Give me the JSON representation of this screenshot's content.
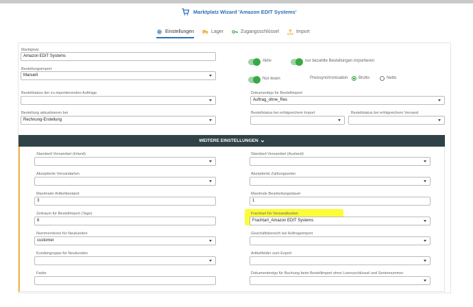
{
  "header": {
    "title": "Marktplatz Wizard 'Amazon EDIT Systems'"
  },
  "tabs": [
    {
      "label": "Einstellungen"
    },
    {
      "label": "Lager"
    },
    {
      "label": "Zugangsschlüssel"
    },
    {
      "label": "Import"
    }
  ],
  "main": {
    "marktplatz": {
      "label": "Marktplatz",
      "value": "Amazon EDIT Systems"
    },
    "bestellungsimport": {
      "label": "Bestellungsimport",
      "value": "Manuell"
    },
    "bestellstatus_import": {
      "label": "Bestellstatus der zu importierenden Aufträge",
      "value": ""
    },
    "bestellung_aktualisieren": {
      "label": "Bestellung aktualisieren bei",
      "value": "Rechnung-Erstellung"
    },
    "aktiv": {
      "label": "Aktiv",
      "on": true
    },
    "nur_bezahlte": {
      "label": "nur bezahlte Bestellungen importieren",
      "on": true
    },
    "nur_lesen": {
      "label": "Nur lesen",
      "on": true
    },
    "preissync": {
      "label": "Preissynchronisation",
      "options": [
        "Brutto",
        "Netto"
      ],
      "selected": "Brutto"
    },
    "dokumenttyp": {
      "label": "Dokumenttyp für Bestellimport",
      "value": "Auftrag_ohne_Res"
    },
    "status_erfolg_import": {
      "label": "Bestellstatus bei erfolgreichem Import",
      "value": ""
    },
    "status_erfolg_versand": {
      "label": "Bestellstatus bei erfolgreichem Versand",
      "value": ""
    }
  },
  "more_settings": {
    "button_label": "WEITERE EINSTELLUNGEN",
    "left": [
      {
        "label": "Standard Versandart (Inland)",
        "value": "",
        "dropdown": true
      },
      {
        "label": "Akzeptierte Versandarten",
        "value": "",
        "dropdown": true
      },
      {
        "label": "Maximaler Artikelbestand",
        "value": "3",
        "dropdown": false
      },
      {
        "label": "Zeitraum für Bestellimport (Tage)",
        "value": "6",
        "dropdown": false
      },
      {
        "label": "Nummernkreis für Neukunden",
        "value": "customer",
        "dropdown": true
      },
      {
        "label": "Kundengruppe für Neukunden",
        "value": "",
        "dropdown": true
      },
      {
        "label": "Farbe",
        "value": "",
        "dropdown": false
      }
    ],
    "right": [
      {
        "label": "Standard Versandart (Ausland)",
        "value": "",
        "dropdown": true
      },
      {
        "label": "Akzeptierte Zahlungsarten",
        "value": "",
        "dropdown": true
      },
      {
        "label": "Maximale Bearbeitungsdauer",
        "value": "1",
        "dropdown": false
      },
      {
        "label": "Frachtart für Versandkosten",
        "value": "Frachtart_Amazon EDIT Systems",
        "dropdown": true
      },
      {
        "label": "Geschäftsbereich bei Auftragsimport",
        "value": "",
        "dropdown": true
      },
      {
        "label": "Artikelfelder zum Export",
        "value": "",
        "dropdown": true
      },
      {
        "label": "Dokumententyp für Buchung beim Bestellimport ohne Lizenzschlüssel und Seriennummer",
        "value": "",
        "dropdown": true
      }
    ]
  },
  "colors": {
    "accent": "#2a6fb5",
    "toggle_on": "#37a945",
    "bar": "#2f4248",
    "highlight": "#fcfc3a",
    "left_border": "#f2b544"
  }
}
